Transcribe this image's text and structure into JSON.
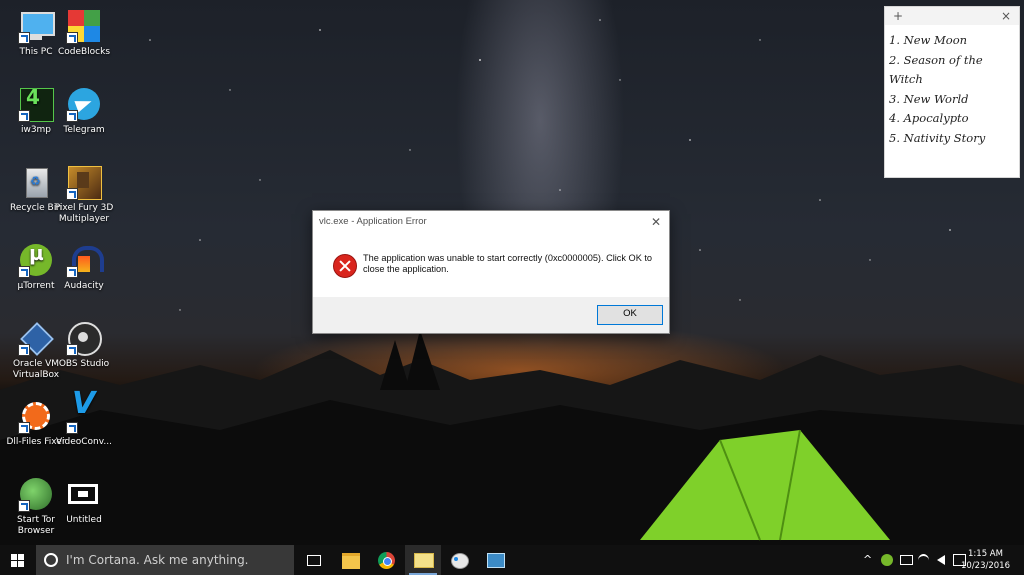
{
  "desktop": {
    "icons": [
      {
        "label": "This PC",
        "icon": "computer-icon"
      },
      {
        "label": "CodeBlocks",
        "icon": "codeblocks-icon"
      },
      {
        "label": "iw3mp",
        "icon": "iw3mp-icon"
      },
      {
        "label": "Telegram",
        "icon": "telegram-icon"
      },
      {
        "label": "Recycle Bin",
        "icon": "recycle-bin-icon"
      },
      {
        "label": "Pixel Fury 3D Multiplayer",
        "icon": "pixel-fury-icon"
      },
      {
        "label": "µTorrent",
        "icon": "utorrent-icon"
      },
      {
        "label": "Audacity",
        "icon": "audacity-icon"
      },
      {
        "label": "Oracle VM VirtualBox",
        "icon": "virtualbox-icon"
      },
      {
        "label": "OBS Studio",
        "icon": "obs-icon"
      },
      {
        "label": "Dll-Files Fixer",
        "icon": "dll-fixer-icon"
      },
      {
        "label": "VideoConv...",
        "icon": "videoconv-icon"
      },
      {
        "label": "Start Tor Browser",
        "icon": "tor-icon"
      },
      {
        "label": "Untitled",
        "icon": "untitled-icon"
      }
    ]
  },
  "sticky": {
    "add": "+",
    "close": "×",
    "items": [
      "1. New Moon",
      "2. Season of the Witch",
      "3. New World",
      "4. Apocalypto",
      "5. Nativity Story"
    ]
  },
  "dialog": {
    "title": "vlc.exe - Application Error",
    "close": "✕",
    "message": "The application was unable to start correctly (0xc0000005). Click OK to close the application.",
    "ok": "OK"
  },
  "taskbar": {
    "search_placeholder": "I'm Cortana. Ask me anything.",
    "tray_chevron": "^",
    "time": "1:15 AM",
    "date": "10/23/2016"
  },
  "colors": {
    "accent": "#0078d7",
    "error": "#d9251d",
    "tent": "#7fd02a",
    "taskbar": "#101010"
  }
}
